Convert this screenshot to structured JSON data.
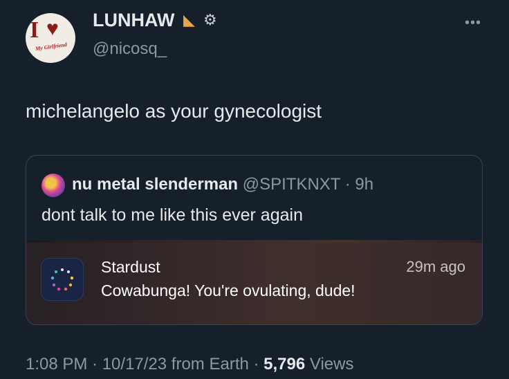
{
  "author": {
    "display_name": "LUNHAW",
    "handle": "@nicosq_",
    "avatar_text": "I",
    "avatar_sub": "My Girlfriend",
    "name_icons": [
      "pizza-icon",
      "gear-icon"
    ]
  },
  "tweet": {
    "text": "michelangelo as your gynecologist"
  },
  "quote": {
    "display_name": "nu metal slenderman",
    "handle_time": "@SPITKNXT · 9h",
    "text": "dont talk to me like this ever again",
    "notification": {
      "app": "Stardust",
      "time": "29m ago",
      "body": "Cowabunga! You're ovulating, dude!"
    }
  },
  "meta": {
    "time_date": "1:08 PM · 10/17/23 from Earth · ",
    "views_count": "5,796",
    "views_label": " Views"
  },
  "colors": {
    "background": "#15202b",
    "text": "#e7e9ea",
    "secondary": "#8b98a5",
    "border": "#38444d"
  }
}
